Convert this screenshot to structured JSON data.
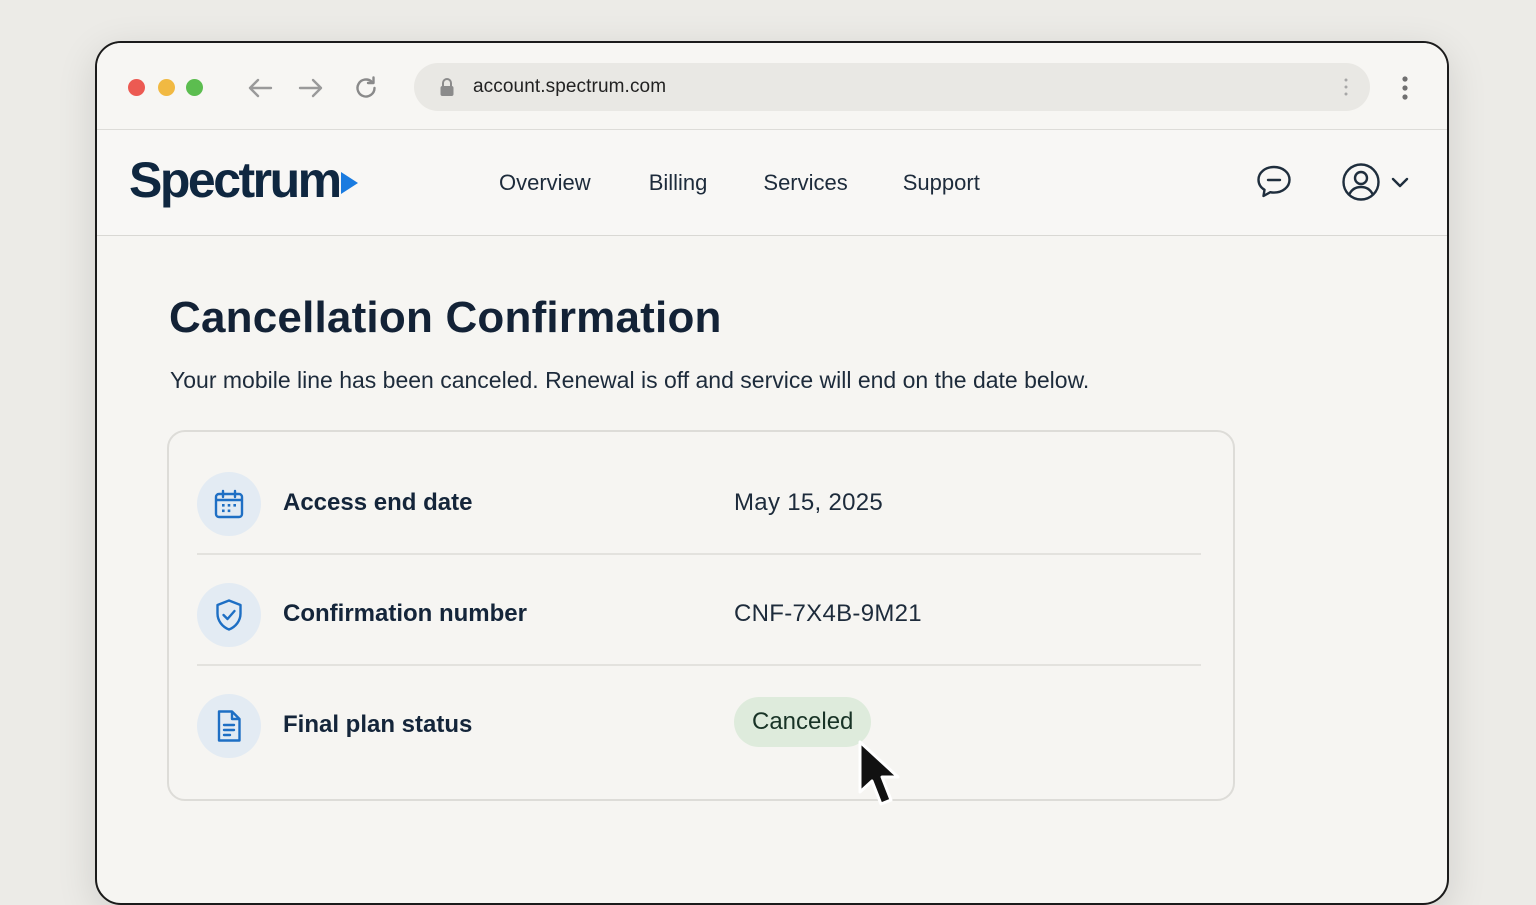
{
  "browser": {
    "url": "account.spectrum.com"
  },
  "site": {
    "logo_text": "Spectrum",
    "nav": [
      "Overview",
      "Billing",
      "Services",
      "Support"
    ],
    "chat_icon": "chat-icon",
    "account_icon": "user-icon"
  },
  "page": {
    "title": "Cancellation Confirmation",
    "subtitle": "Your mobile line has been canceled. Renewal is off and service will end on the date below."
  },
  "details": [
    {
      "icon": "calendar-icon",
      "label": "Access end date",
      "value": "May 15, 2025"
    },
    {
      "icon": "shield-check-icon",
      "label": "Confirmation number",
      "value": "CNF-7X4B-9M21"
    },
    {
      "icon": "document-icon",
      "label": "Final plan status",
      "value": "Canceled"
    }
  ],
  "colors": {
    "brand_navy": "#0f2740",
    "brand_blue": "#1a7be0",
    "status_canceled_bg": "#deebdc",
    "icon_circle_bg": "#e3ebf3"
  }
}
